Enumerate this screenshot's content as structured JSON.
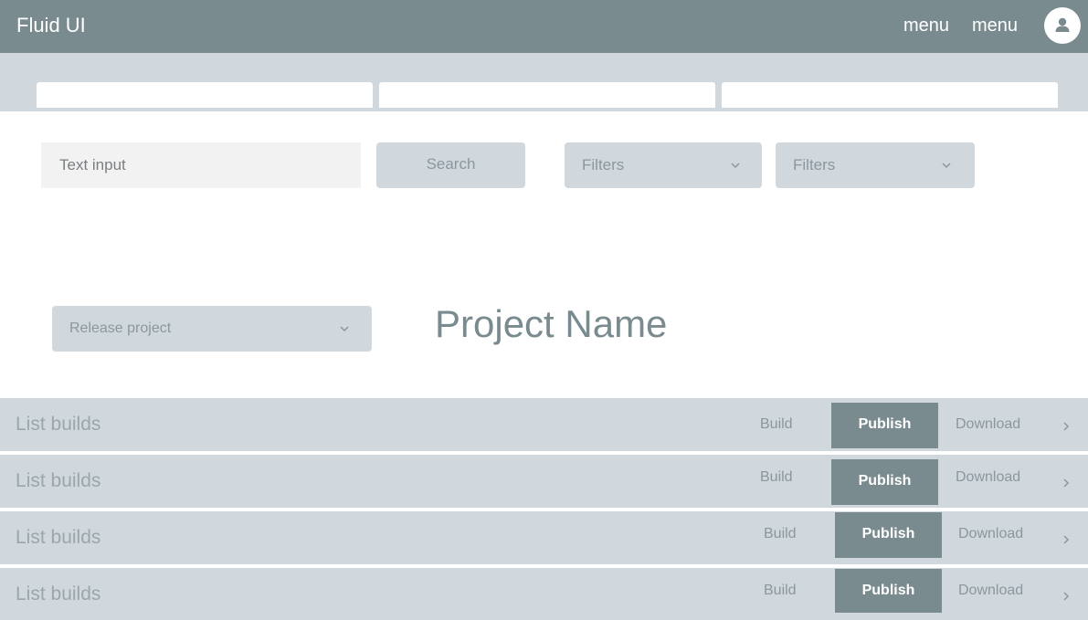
{
  "header": {
    "brand": "Fluid UI",
    "menu_items": [
      "menu",
      "menu"
    ]
  },
  "tabs": [
    {
      "label": ""
    },
    {
      "label": ""
    },
    {
      "label": ""
    }
  ],
  "search": {
    "placeholder": "Text input",
    "button_label": "Search"
  },
  "filters": [
    {
      "label": "Filters"
    },
    {
      "label": "Filters"
    }
  ],
  "release_select": {
    "label": "Release project"
  },
  "project_title": "Project Name",
  "list_rows": [
    {
      "label": "List builds",
      "build": "Build",
      "publish": "Publish",
      "download": "Download"
    },
    {
      "label": "List builds",
      "build": "Build",
      "publish": "Publish",
      "download": "Download"
    },
    {
      "label": "List builds",
      "build": "Build",
      "publish": "Publish",
      "download": "Download"
    },
    {
      "label": "List builds",
      "build": "Build",
      "publish": "Publish",
      "download": "Download"
    }
  ],
  "icons": {
    "avatar": "user-avatar-icon",
    "dropdown": "chevron-down-icon",
    "row_action": "chevron-right-icon"
  },
  "colors": {
    "header_bg": "#7a8b90",
    "panel_bg": "#d0d8dd",
    "publish_bg": "#7a8b90",
    "muted_text": "#8b979d"
  }
}
